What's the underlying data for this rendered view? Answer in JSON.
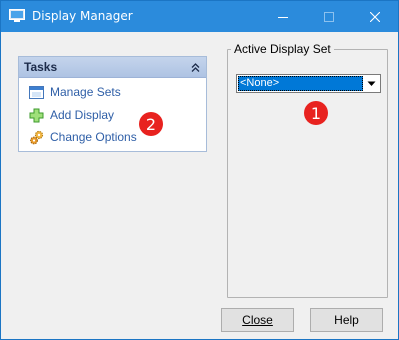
{
  "window": {
    "title": "Display Manager",
    "accent_color": "#2b8bdc"
  },
  "tasks_panel": {
    "title": "Tasks",
    "items": [
      {
        "label": "Manage Sets",
        "icon": "window-icon"
      },
      {
        "label": "Add Display",
        "icon": "plus-icon"
      },
      {
        "label": "Change Options",
        "icon": "gears-icon"
      }
    ]
  },
  "active_display_set": {
    "legend": "Active Display Set",
    "selected": "<None>"
  },
  "buttons": {
    "close_label": "Close",
    "help_label": "Help"
  },
  "markers": [
    "1",
    "2"
  ]
}
